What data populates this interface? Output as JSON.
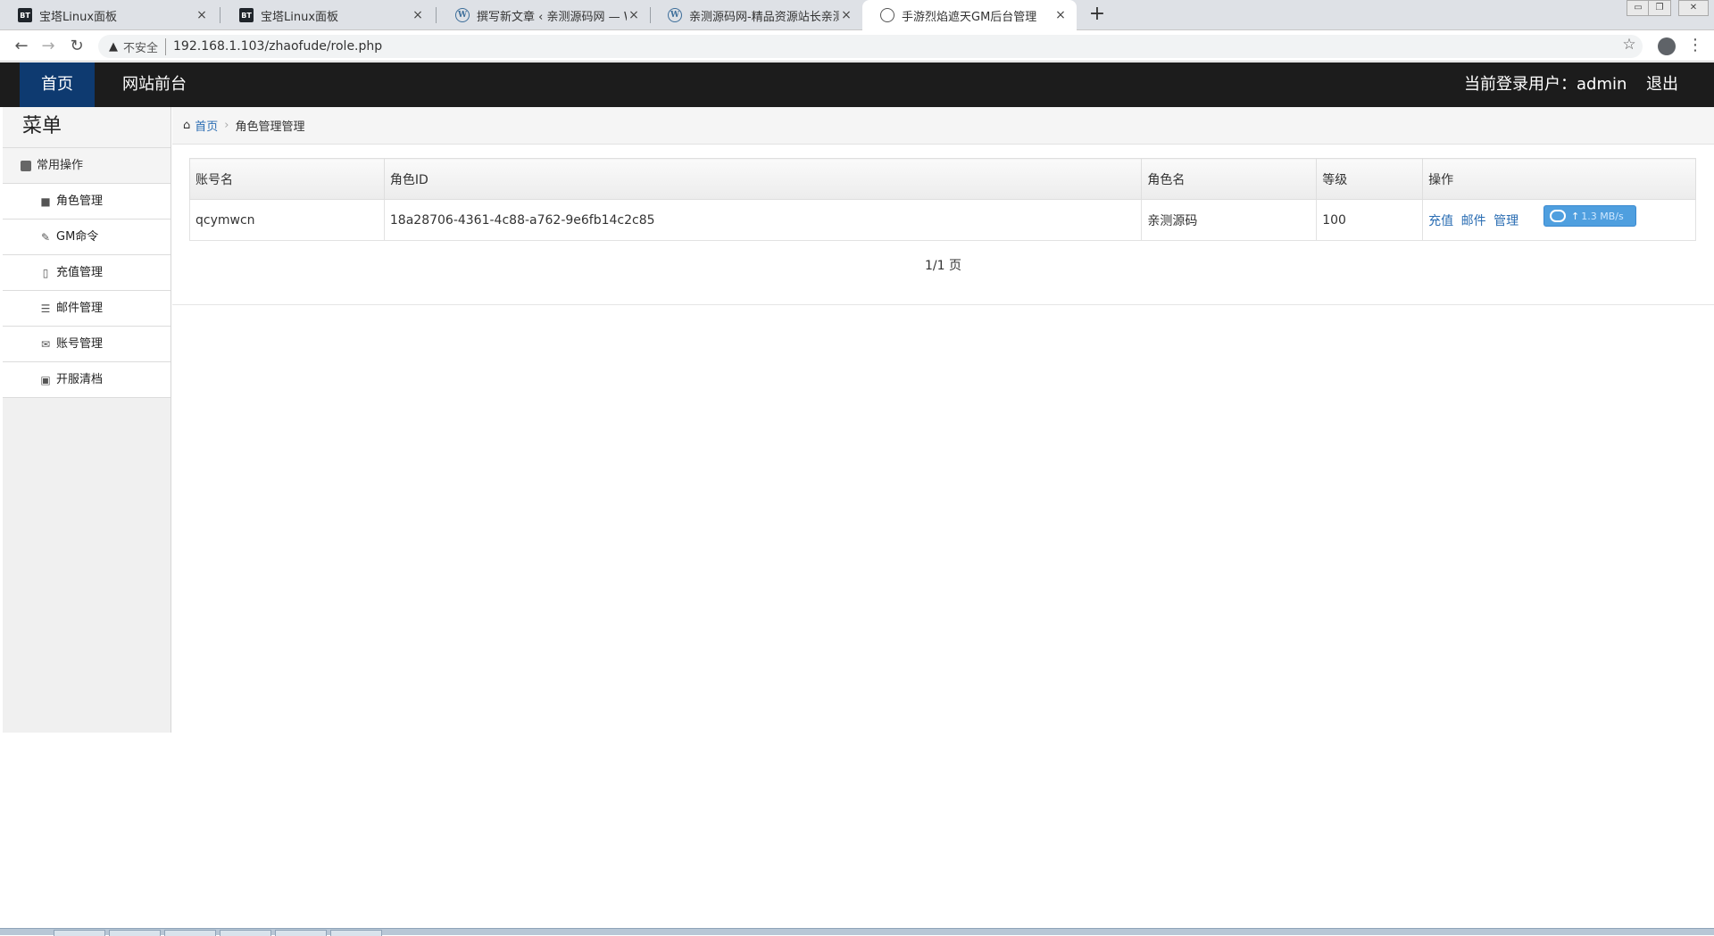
{
  "browser": {
    "tabs": [
      {
        "title": "宝塔Linux面板",
        "icon": "bt-icon",
        "active": false
      },
      {
        "title": "宝塔Linux面板",
        "icon": "bt-icon",
        "active": false
      },
      {
        "title": "撰写新文章 ‹ 亲测源码网 — Wo",
        "icon": "wordpress-icon",
        "active": false
      },
      {
        "title": "亲测源码网-精品资源站长亲测",
        "icon": "wordpress-icon",
        "active": false
      },
      {
        "title": "手游烈焰遮天GM后台管理",
        "icon": "globe-icon",
        "active": true
      }
    ],
    "tab_close": "×",
    "new_tab": "+",
    "address": {
      "security_label": "不安全",
      "url": "192.168.1.103/zhaofude/role.php"
    }
  },
  "navbar": {
    "items": [
      {
        "label": "首页",
        "active": true
      },
      {
        "label": "网站前台",
        "active": false
      }
    ],
    "user_label": "当前登录用户：admin",
    "logout_label": "退出",
    "colors": {
      "background": "#1c1c1c",
      "active": "#0e3a70"
    }
  },
  "sidebar": {
    "title": "菜单",
    "group_label": "常用操作",
    "items": [
      {
        "label": "角色管理",
        "icon": "video-icon"
      },
      {
        "label": "GM命令",
        "icon": "wrench-icon"
      },
      {
        "label": "充值管理",
        "icon": "file-icon"
      },
      {
        "label": "邮件管理",
        "icon": "list-icon"
      },
      {
        "label": "账号管理",
        "icon": "envelope-icon"
      },
      {
        "label": "开服清档",
        "icon": "picture-icon"
      }
    ]
  },
  "breadcrumb": {
    "home": "首页",
    "current": "角色管理管理"
  },
  "table": {
    "columns": [
      "账号名",
      "角色ID",
      "角色名",
      "等级",
      "操作"
    ],
    "rows": [
      {
        "account": "qcymwcn",
        "role_id": "18a28706-4361-4c88-a762-9e6fb14c2c85",
        "role_name": "亲测源码",
        "level": "100",
        "actions": [
          "充值",
          "邮件",
          "管理"
        ]
      }
    ]
  },
  "pagination": "1/1 页",
  "upload_widget": {
    "speed": "1.3 MB/s"
  }
}
